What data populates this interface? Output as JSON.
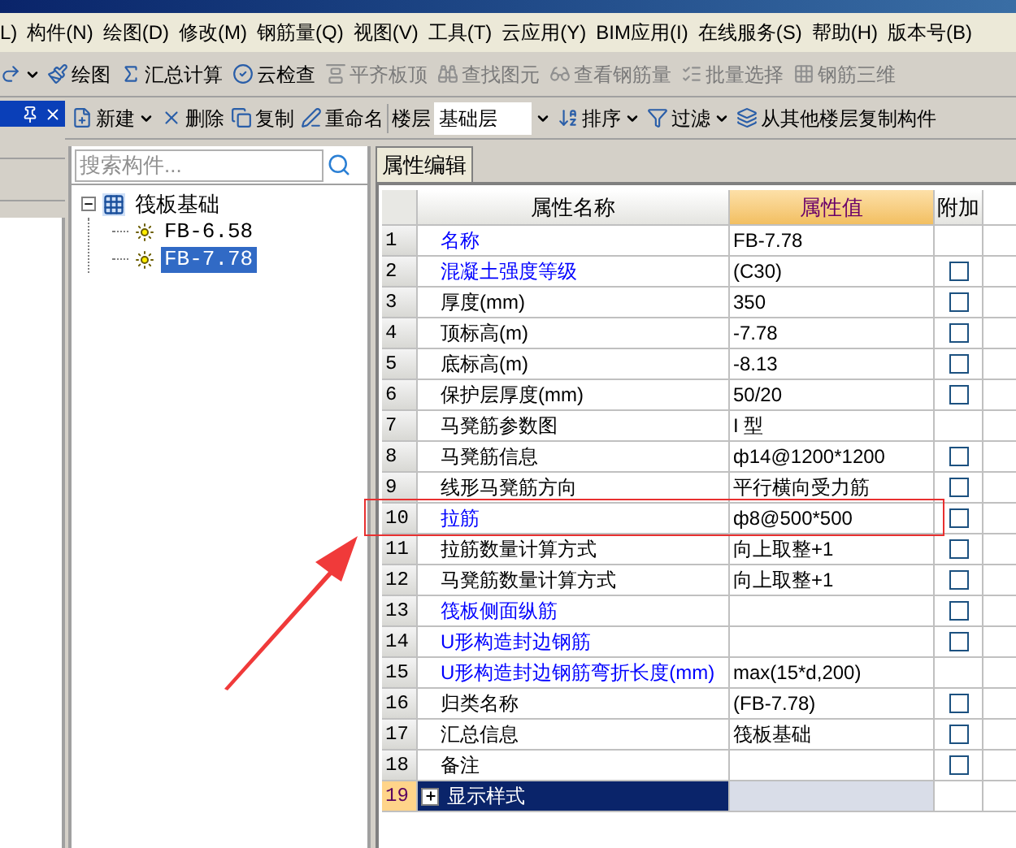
{
  "menu_bar": [
    "L)",
    "构件(N)",
    "绘图(D)",
    "修改(M)",
    "钢筋量(Q)",
    "视图(V)",
    "工具(T)",
    "云应用(Y)",
    "BIM应用(I)",
    "在线服务(S)",
    "帮助(H)",
    "版本号(B)"
  ],
  "main_toolbar": [
    {
      "label": "绘图",
      "disabled": false
    },
    {
      "label": "汇总计算",
      "disabled": false
    },
    {
      "label": "云检查",
      "disabled": false
    },
    {
      "label": "平齐板顶",
      "disabled": true
    },
    {
      "label": "查找图元",
      "disabled": true
    },
    {
      "label": "查看钢筋量",
      "disabled": true
    },
    {
      "label": "批量选择",
      "disabled": true
    },
    {
      "label": "钢筋三维",
      "disabled": true
    }
  ],
  "component_toolbar": {
    "buttons_left": [
      {
        "label": "新建",
        "dropdown": true
      },
      {
        "label": "删除",
        "dropdown": false
      },
      {
        "label": "复制",
        "dropdown": false
      },
      {
        "label": "重命名",
        "dropdown": false
      }
    ],
    "floor_label": "楼层",
    "floor_value": "基础层",
    "buttons_right": [
      {
        "label": "排序",
        "dropdown": true
      },
      {
        "label": "过滤",
        "dropdown": true
      },
      {
        "label": "从其他楼层复制构件",
        "dropdown": false
      }
    ]
  },
  "tree": {
    "search": {
      "placeholder": "搜索构件..."
    },
    "items": [
      {
        "label": "筏板基础",
        "expanded": true,
        "selected": false,
        "children": [
          {
            "label": "FB-6.58",
            "selected": false
          },
          {
            "label": "FB-7.78",
            "selected": true
          }
        ]
      }
    ]
  },
  "property_panel": {
    "tab": "属性编辑",
    "columns": [
      "属性名称",
      "属性值",
      "附加"
    ],
    "rows": [
      {
        "index": "1",
        "name": "名称",
        "color": "#0000ff",
        "value": "FB-7.78",
        "kind": "plain"
      },
      {
        "index": "2",
        "name": "混凝土强度等级",
        "color": "#0000ff",
        "value": "(C30)",
        "kind": "checkbox",
        "checked": false
      },
      {
        "index": "3",
        "name": "厚度(mm)",
        "color": "#000000",
        "value": "350",
        "kind": "checkbox",
        "checked": false
      },
      {
        "index": "4",
        "name": "顶标高(m)",
        "color": "#000000",
        "value": "-7.78",
        "kind": "checkbox",
        "checked": false
      },
      {
        "index": "5",
        "name": "底标高(m)",
        "color": "#000000",
        "value": "-8.13",
        "kind": "checkbox",
        "checked": false
      },
      {
        "index": "6",
        "name": "保护层厚度(mm)",
        "color": "#000000",
        "value": "50/20",
        "kind": "checkbox",
        "checked": false
      },
      {
        "index": "7",
        "name": "马凳筋参数图",
        "color": "#000000",
        "value": "I 型",
        "kind": "plain"
      },
      {
        "index": "8",
        "name": "马凳筋信息",
        "color": "#000000",
        "value": "ф14@1200*1200",
        "kind": "checkbox",
        "checked": false
      },
      {
        "index": "9",
        "name": "线形马凳筋方向",
        "color": "#000000",
        "value": "平行横向受力筋",
        "kind": "checkbox",
        "checked": false
      },
      {
        "index": "10",
        "name": "拉筋",
        "color": "#0000ff",
        "value": "ф8@500*500",
        "kind": "checkbox",
        "checked": false
      },
      {
        "index": "11",
        "name": "拉筋数量计算方式",
        "color": "#000000",
        "value": "向上取整+1",
        "kind": "checkbox",
        "checked": false
      },
      {
        "index": "12",
        "name": "马凳筋数量计算方式",
        "color": "#000000",
        "value": "向上取整+1",
        "kind": "checkbox",
        "checked": false
      },
      {
        "index": "13",
        "name": "筏板侧面纵筋",
        "color": "#0000ff",
        "value": "",
        "kind": "checkbox",
        "checked": false
      },
      {
        "index": "14",
        "name": "U形构造封边钢筋",
        "color": "#0000ff",
        "value": "",
        "kind": "checkbox",
        "checked": false
      },
      {
        "index": "15",
        "name": "U形构造封边钢筋弯折长度(mm)",
        "color": "#0000ff",
        "value": "max(15*d,200)",
        "kind": "plain"
      },
      {
        "index": "16",
        "name": "归类名称",
        "color": "#000000",
        "value": "(FB-7.78)",
        "kind": "checkbox",
        "checked": false
      },
      {
        "index": "17",
        "name": "汇总信息",
        "color": "#000000",
        "value": "筏板基础",
        "kind": "checkbox",
        "checked": false
      },
      {
        "index": "18",
        "name": "备注",
        "color": "#000000",
        "value": "",
        "kind": "checkbox",
        "checked": false
      },
      {
        "index": "19",
        "name": "显示样式",
        "value": "",
        "kind": "group",
        "expanded": false,
        "selected": true
      }
    ]
  }
}
